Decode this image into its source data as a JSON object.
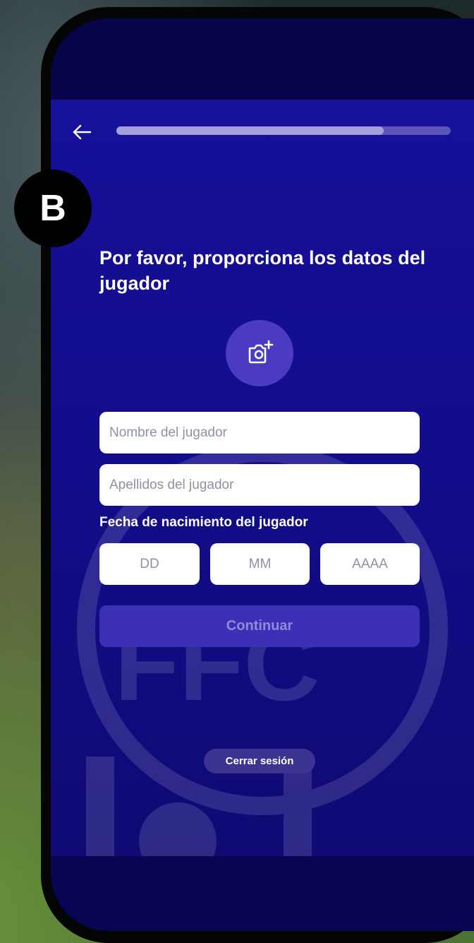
{
  "header": {
    "back_icon": "arrow-left-icon",
    "progress": 0.8
  },
  "badge": {
    "letter": "B"
  },
  "form": {
    "title": "Por favor, proporciona los datos del jugador",
    "photo_icon": "camera-add-icon",
    "first_name_placeholder": "Nombre del jugador",
    "last_name_placeholder": "Apellidos del jugador",
    "dob_label": "Fecha de nacimiento del jugador",
    "dob_day_placeholder": "DD",
    "dob_month_placeholder": "MM",
    "dob_year_placeholder": "AAAA",
    "continue_label": "Continuar",
    "logout_label": "Cerrar sesión"
  },
  "colors": {
    "background": "#130d8c",
    "primary_button": "#3b30b6",
    "photo_button": "#4b3bc2"
  }
}
